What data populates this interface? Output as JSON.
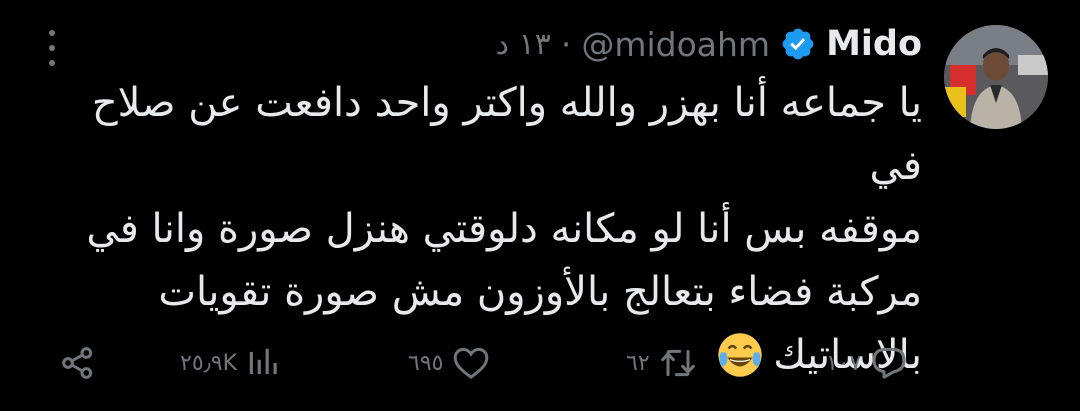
{
  "author": {
    "name": "Mido",
    "handle": "@midoahm",
    "separator": "·",
    "time": "١٣ د"
  },
  "tweet": {
    "lines": [
      "يا جماعه أنا بهزر والله واكتر واحد دافعت عن صلاح في",
      "موقفه بس أنا لو مكانه دلوقتي هنزل صورة وانا في",
      "مركبة فضاء بتعالج بالأوزون مش صورة تقويات",
      "بالاساتيك"
    ],
    "emoji": "face-with-tears-of-joy"
  },
  "actions": {
    "replies": "١٠٧",
    "retweets": "٦٢",
    "likes": "٦٩٥",
    "views": "٢٥٫٩K"
  },
  "colors": {
    "background": "#000000",
    "text": "#e7e9ea",
    "secondary": "#71767b",
    "verified": "#1d9bf0",
    "emoji": "#ffcc4d"
  },
  "icons": [
    "more-vertical-icon",
    "verified-badge-icon",
    "share-icon",
    "views-icon",
    "like-icon",
    "retweet-icon",
    "reply-icon"
  ]
}
